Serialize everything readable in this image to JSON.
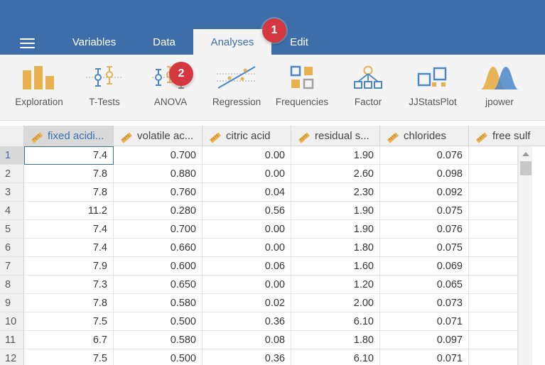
{
  "nav": {
    "tabs": [
      {
        "label": "Variables"
      },
      {
        "label": "Data"
      },
      {
        "label": "Analyses",
        "active": true
      },
      {
        "label": "Edit"
      }
    ]
  },
  "badges": [
    "1",
    "2"
  ],
  "ribbon": {
    "buttons": [
      {
        "label": "Exploration",
        "icon": "exploration-bar-chart-icon"
      },
      {
        "label": "T-Tests",
        "icon": "t-tests-icon"
      },
      {
        "label": "ANOVA",
        "icon": "anova-icon"
      },
      {
        "label": "Regression",
        "icon": "regression-icon"
      },
      {
        "label": "Frequencies",
        "icon": "frequencies-icon"
      },
      {
        "label": "Factor",
        "icon": "factor-icon"
      },
      {
        "label": "JJStatsPlot",
        "icon": "jjstatsplot-icon"
      },
      {
        "label": "jpower",
        "icon": "jpower-distribution-icon"
      }
    ]
  },
  "grid": {
    "columns": [
      "fixed acidi...",
      "volatile ac...",
      "citric acid",
      "residual s...",
      "chlorides",
      "free sulf"
    ],
    "rows": [
      {
        "num": "1",
        "cells": [
          "7.4",
          "0.700",
          "0.00",
          "1.90",
          "0.076"
        ]
      },
      {
        "num": "2",
        "cells": [
          "7.8",
          "0.880",
          "0.00",
          "2.60",
          "0.098"
        ]
      },
      {
        "num": "3",
        "cells": [
          "7.8",
          "0.760",
          "0.04",
          "2.30",
          "0.092"
        ]
      },
      {
        "num": "4",
        "cells": [
          "11.2",
          "0.280",
          "0.56",
          "1.90",
          "0.075"
        ]
      },
      {
        "num": "5",
        "cells": [
          "7.4",
          "0.700",
          "0.00",
          "1.90",
          "0.076"
        ]
      },
      {
        "num": "6",
        "cells": [
          "7.4",
          "0.660",
          "0.00",
          "1.80",
          "0.075"
        ]
      },
      {
        "num": "7",
        "cells": [
          "7.9",
          "0.600",
          "0.06",
          "1.60",
          "0.069"
        ]
      },
      {
        "num": "8",
        "cells": [
          "7.3",
          "0.650",
          "0.00",
          "1.20",
          "0.065"
        ]
      },
      {
        "num": "9",
        "cells": [
          "7.8",
          "0.580",
          "0.02",
          "2.00",
          "0.073"
        ]
      },
      {
        "num": "10",
        "cells": [
          "7.5",
          "0.500",
          "0.36",
          "6.10",
          "0.071"
        ]
      },
      {
        "num": "11",
        "cells": [
          "6.7",
          "0.580",
          "0.08",
          "1.80",
          "0.097"
        ]
      },
      {
        "num": "12",
        "cells": [
          "7.5",
          "0.500",
          "0.36",
          "6.10",
          "0.071"
        ]
      }
    ]
  },
  "colors": {
    "brand_blue": "#3e6eaa",
    "badge_red": "#d3373f",
    "ribbon_bg": "#f4f4f4",
    "icon_orange": "#e8b04e",
    "icon_blue": "#4a86c8"
  }
}
